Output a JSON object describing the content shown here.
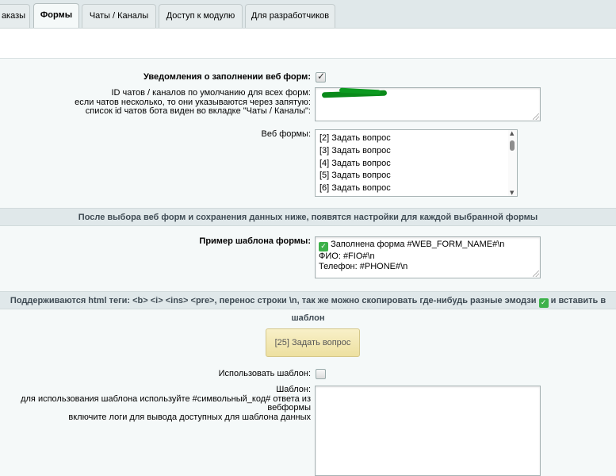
{
  "tabs": [
    {
      "label": "аказы"
    },
    {
      "label": "Формы"
    },
    {
      "label": "Чаты / Каналы"
    },
    {
      "label": "Доступ к модулю"
    },
    {
      "label": "Для разработчиков"
    }
  ],
  "notify": {
    "label": "Уведомления о заполнении веб форм:",
    "checked": true
  },
  "chat_ids": {
    "label_lines": [
      "ID чатов / каналов по умолчанию для всех форм:",
      "если чатов несколько, то они указываются через запятую:",
      "список id чатов бота виден во вкладке \"Чаты / Каналы\":"
    ]
  },
  "web_forms": {
    "label": "Веб формы:",
    "options": [
      "[2] Задать вопрос",
      "[3] Задать вопрос",
      "[4] Задать вопрос",
      "[5] Задать вопрос",
      "[6] Задать вопрос"
    ]
  },
  "section1": {
    "title": "После выбора веб форм и сохранения данных ниже, появятся настройки для каждой выбранной формы"
  },
  "template_example": {
    "label": "Пример шаблона формы:",
    "lines": [
      "Заполнена форма #WEB_FORM_NAME#\\n",
      "ФИО: #FIO#\\n",
      "Телефон: #PHONE#\\n"
    ],
    "emoji": "white-heavy-check-mark"
  },
  "section2": {
    "title_before": "Поддерживаются html теги: <b> <i> <ins> <pre>, перенос строки \\n, так же можно скопировать где-нибудь разные эмодзи",
    "title_after": "и вставить в шаблон"
  },
  "form_button": {
    "label": "[25] Задать вопрос"
  },
  "use_template": {
    "label": "Использовать шаблон:",
    "checked": false
  },
  "template_field": {
    "label_lines": [
      "Шаблон:",
      "для использования шаблона используйте #символьный_код# ответа из вебформы",
      "включите логи для вывода доступных для шаблона данных"
    ]
  },
  "colors": {
    "accent_green": "#3db14a",
    "button_yellow": "#f3e8b4",
    "section_bg": "#e0e8ea"
  }
}
